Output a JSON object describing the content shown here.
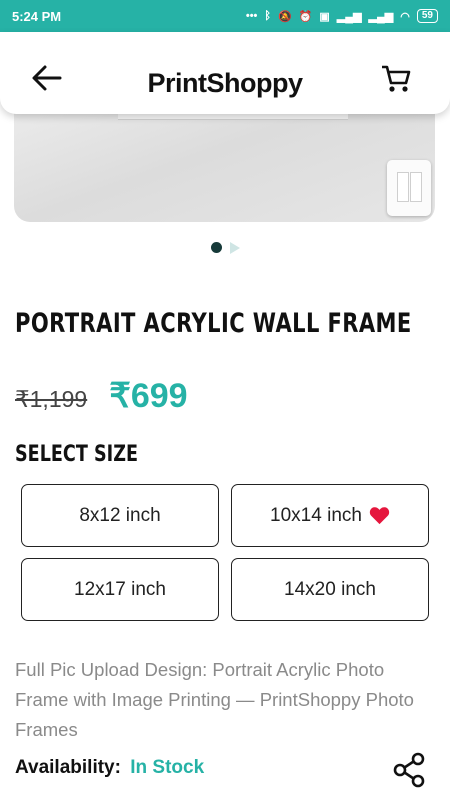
{
  "status_bar": {
    "time": "5:24 PM",
    "battery": "59",
    "indicators": [
      "...",
      "bluetooth-icon",
      "mute-icon",
      "alarm-icon",
      "volte-icon",
      "signal-icon",
      "signal-icon",
      "wifi-icon"
    ]
  },
  "header": {
    "brand": "PrintShoppy",
    "back_icon": "arrow-left-icon",
    "cart_icon": "shopping-cart-icon"
  },
  "carousel": {
    "count": 2,
    "active_index": 0
  },
  "product": {
    "title": "PORTRAIT ACRYLIC WALL FRAME",
    "old_price": "₹1,199",
    "price": "₹699"
  },
  "size_selector": {
    "heading": "SELECT SIZE",
    "options": [
      {
        "label": "8x12 inch",
        "favorite": false
      },
      {
        "label": "10x14 inch",
        "favorite": true
      },
      {
        "label": "12x17 inch",
        "favorite": false
      },
      {
        "label": "14x20 inch",
        "favorite": false
      }
    ]
  },
  "description": "Full Pic Upload Design: Portrait Acrylic Photo Frame with Image Printing — PrintShoppy Photo Frames",
  "availability": {
    "label": "Availability:",
    "value": "In Stock"
  },
  "colors": {
    "teal": "#26b2a6",
    "dark": "#111111",
    "muted": "#8a8a8a",
    "heart": "#e5163d"
  }
}
